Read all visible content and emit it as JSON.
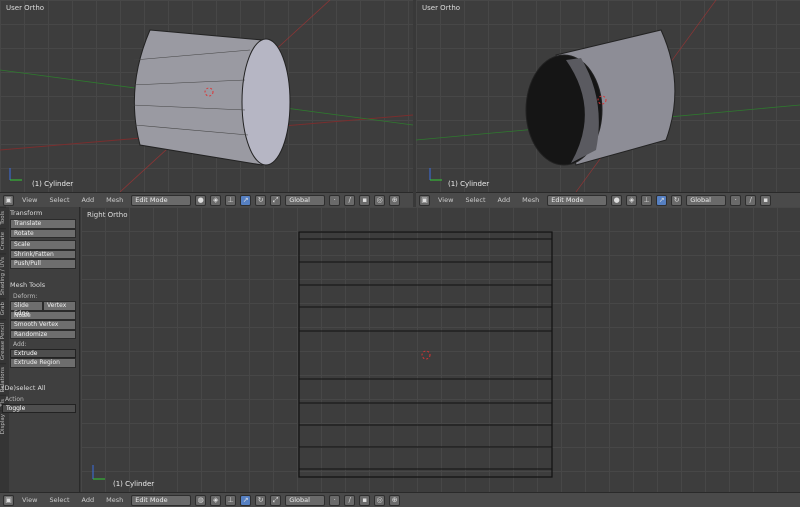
{
  "viewports": {
    "top_left": {
      "label": "User Ortho",
      "object": "(1) Cylinder"
    },
    "top_right": {
      "label": "User Ortho",
      "object": "(1) Cylinder"
    },
    "bottom": {
      "label": "Right Ortho",
      "object": "(1) Cylinder"
    }
  },
  "header": {
    "menus": [
      "View",
      "Select",
      "Add",
      "Mesh"
    ],
    "mode": "Edit Mode",
    "orientation": "Global"
  },
  "shelf": {
    "tabs": [
      "Tools",
      "Create",
      "Shading / UVs",
      "Grab",
      "Grease Pencil",
      "Relations",
      "Tls",
      "Display"
    ],
    "transform": {
      "title": "Transform",
      "buttons": [
        "Translate",
        "Rotate",
        "Scale",
        "Shrink/Fatten",
        "Push/Pull"
      ]
    },
    "mesh_tools": {
      "title": "Mesh Tools",
      "deform_label": "Deform:",
      "slide_edge": "Slide Edge",
      "vertex": "Vertex",
      "buttons": [
        "Noise",
        "Smooth Vertex",
        "Randomize"
      ],
      "add_label": "Add:",
      "extrude": "Extrude",
      "extrude_region": "Extrude Region"
    },
    "operator": {
      "title": "(De)select All",
      "action_label": "Action",
      "action_value": "Toggle"
    }
  }
}
